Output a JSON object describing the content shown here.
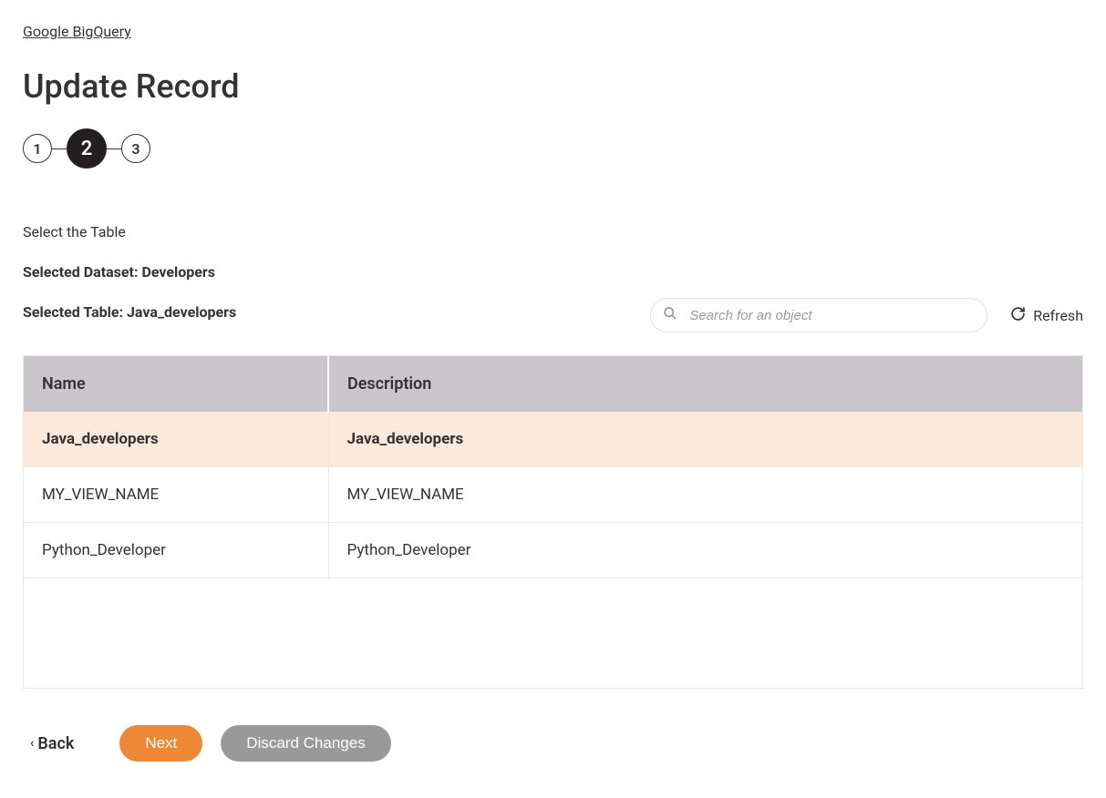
{
  "breadcrumb": "Google BigQuery",
  "page_title": "Update Record",
  "stepper": {
    "steps": [
      "1",
      "2",
      "3"
    ],
    "active_index": 1
  },
  "section_label": "Select the Table",
  "selected_dataset_label": "Selected Dataset: Developers",
  "selected_table_label": "Selected Table: Java_developers",
  "search": {
    "placeholder": "Search for an object"
  },
  "refresh_label": "Refresh",
  "table": {
    "headers": [
      "Name",
      "Description"
    ],
    "rows": [
      {
        "name": "Java_developers",
        "description": "Java_developers",
        "selected": true
      },
      {
        "name": "MY_VIEW_NAME",
        "description": "MY_VIEW_NAME",
        "selected": false
      },
      {
        "name": "Python_Developer",
        "description": "Python_Developer",
        "selected": false
      }
    ]
  },
  "footer": {
    "back": "Back",
    "next": "Next",
    "discard": "Discard Changes"
  }
}
